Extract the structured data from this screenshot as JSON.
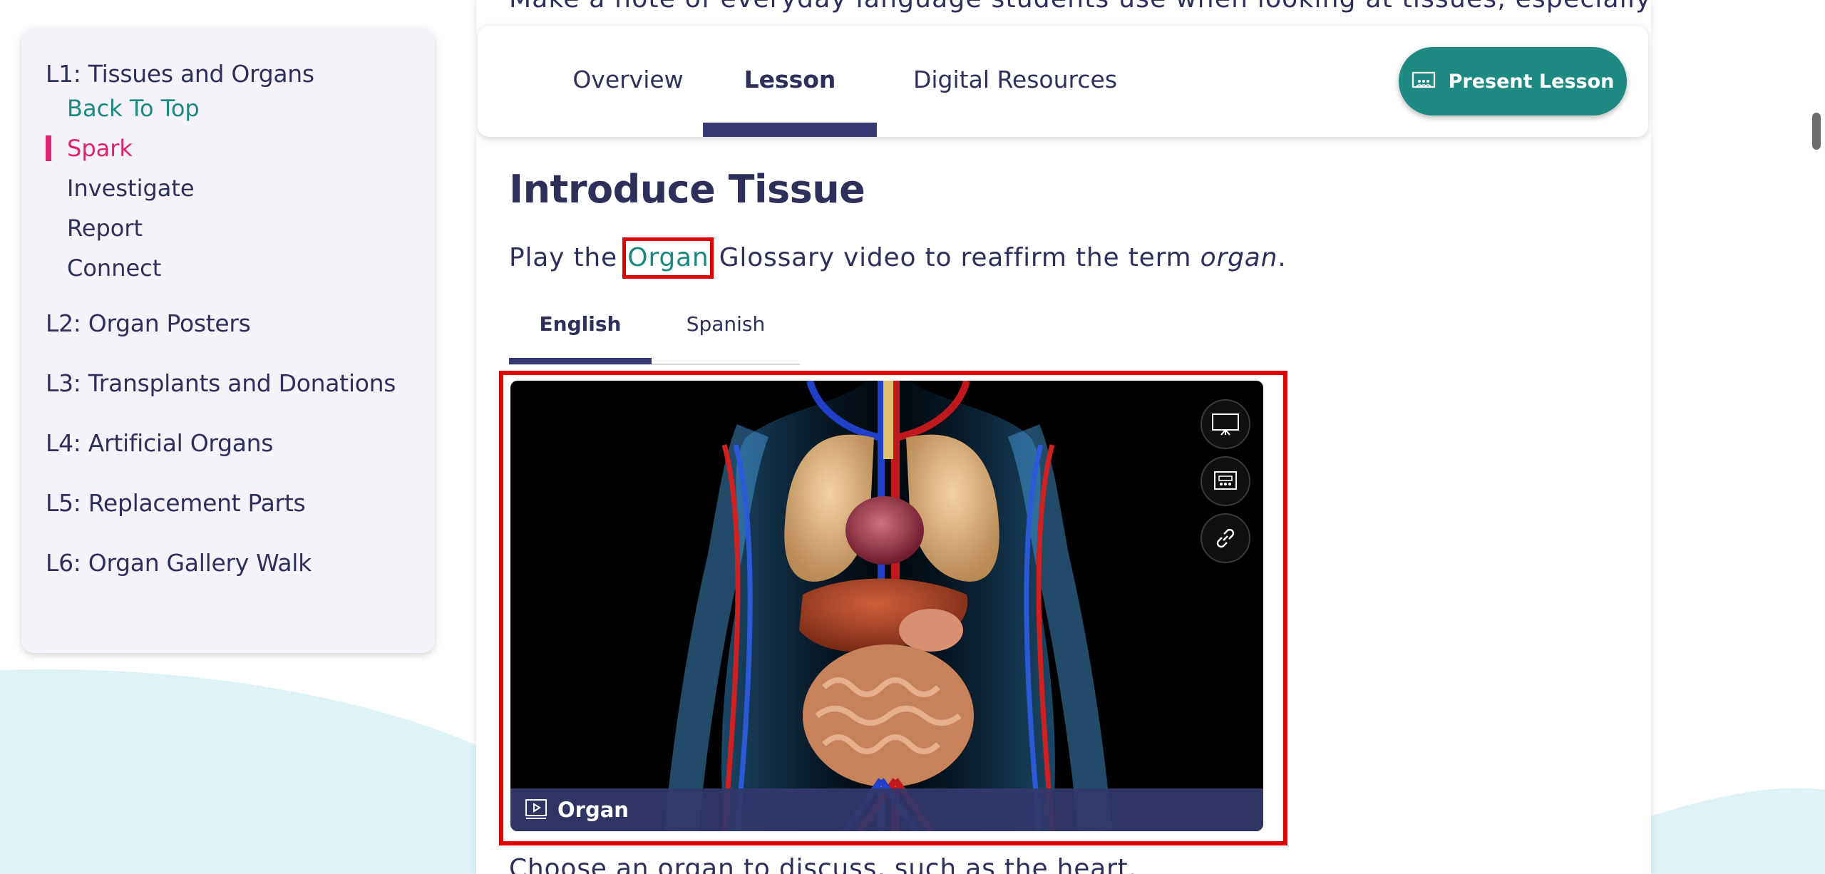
{
  "sidebar": {
    "lesson1": "L1: Tissues and Organs",
    "sub_items": [
      {
        "label": "Back To Top"
      },
      {
        "label": "Spark"
      },
      {
        "label": "Investigate"
      },
      {
        "label": "Report"
      },
      {
        "label": "Connect"
      }
    ],
    "lessons": [
      "L2: Organ Posters",
      "L3: Transplants and Donations",
      "L4: Artificial Organs",
      "L5: Replacement Parts",
      "L6: Organ Gallery Walk"
    ]
  },
  "top_cut_text": "Make a note of everyday language students use when looking at tissues, especially that",
  "tabs": {
    "overview": "Overview",
    "lesson": "Lesson",
    "digital_resources": "Digital Resources",
    "active": "Lesson"
  },
  "present_button": "Present Lesson",
  "section": {
    "title": "Introduce Tissue",
    "intro_before": "Play the ",
    "intro_link": "Organ",
    "intro_after": " Glossary video to reaffirm the term ",
    "intro_term": "organ",
    "intro_end": "."
  },
  "language_tabs": {
    "english": "English",
    "spanish": "Spanish",
    "active": "English"
  },
  "video": {
    "caption": "Organ",
    "buttons": [
      "present-icon",
      "classroom-display-icon",
      "link-icon"
    ]
  },
  "bottom_text": "Choose an organ to discuss, such as the heart.",
  "colors": {
    "accent_teal": "#1e8a82",
    "active_pink": "#e2226f",
    "navy": "#2e2f5b",
    "highlight_red": "#e10000"
  }
}
